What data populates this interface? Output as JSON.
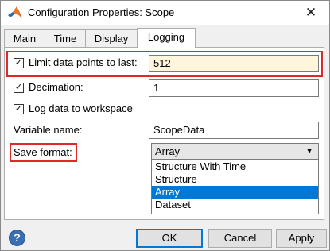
{
  "window": {
    "title": "Configuration Properties: Scope",
    "close_glyph": "✕"
  },
  "tabs": [
    {
      "label": "Main"
    },
    {
      "label": "Time"
    },
    {
      "label": "Display"
    },
    {
      "label": "Logging"
    }
  ],
  "active_tab": "Logging",
  "logging": {
    "limit_points": {
      "label": "Limit data points to last:",
      "checked": true,
      "value": "512"
    },
    "decimation": {
      "label": "Decimation:",
      "checked": true,
      "value": "1"
    },
    "log_to_workspace": {
      "label": "Log data to workspace",
      "checked": true
    },
    "variable_name": {
      "label": "Variable name:",
      "value": "ScopeData"
    },
    "save_format": {
      "label": "Save format:",
      "selected": "Array",
      "options": [
        "Structure With Time",
        "Structure",
        "Array",
        "Dataset"
      ]
    }
  },
  "buttons": {
    "ok": "OK",
    "cancel": "Cancel",
    "apply": "Apply",
    "help_glyph": "?"
  },
  "checkmark": "✓",
  "dropdown_arrow": "▼",
  "colors": {
    "highlight_box": "#e02828",
    "selection": "#0078d7",
    "active_field_bg": "#fff4dc"
  }
}
